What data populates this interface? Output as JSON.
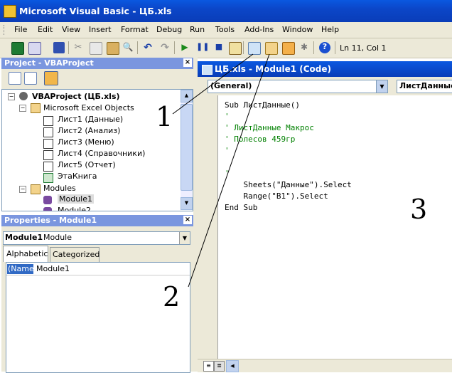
{
  "window": {
    "title": "Microsoft Visual Basic - ЦБ.xls"
  },
  "menu": [
    "File",
    "Edit",
    "View",
    "Insert",
    "Format",
    "Debug",
    "Run",
    "Tools",
    "Add-Ins",
    "Window",
    "Help"
  ],
  "toolbar": {
    "position": "Ln 11, Col 1"
  },
  "project": {
    "title": "Project - VBAProject",
    "root": "VBAProject (ЦБ.xls)",
    "excel_objects": "Microsoft Excel Objects",
    "sheets": [
      "Лист1 (Данные)",
      "Лист2 (Анализ)",
      "Лист3 (Меню)",
      "Лист4 (Справочники)",
      "Лист5 (Отчет)",
      "ЭтаКнига"
    ],
    "modules": "Modules",
    "module_items": [
      "Module1",
      "Module2"
    ]
  },
  "properties": {
    "title": "Properties - Module1",
    "object": "Module1",
    "object_type": "Module",
    "tabs": [
      "Alphabetic",
      "Categorized"
    ],
    "prop_name": "(Name)",
    "prop_value": "Module1"
  },
  "code": {
    "title": "ЦБ.xls - Module1 (Code)",
    "object_combo": "(General)",
    "proc_combo": "ЛистДанные",
    "lines": [
      {
        "text": "Sub ЛистДанные()",
        "comment": false
      },
      {
        "text": "'",
        "comment": true
      },
      {
        "text": "' ЛистДанные Макрос",
        "comment": true
      },
      {
        "text": "' Полесов 459гр",
        "comment": true
      },
      {
        "text": "'",
        "comment": true
      },
      {
        "text": "",
        "comment": false
      },
      {
        "text": "'",
        "comment": true
      },
      {
        "text": "    Sheets(\"Данные\").Select",
        "comment": false
      },
      {
        "text": "    Range(\"B1\").Select",
        "comment": false
      },
      {
        "text": "End Sub",
        "comment": false
      }
    ]
  },
  "annotations": [
    "1",
    "2",
    "3"
  ]
}
